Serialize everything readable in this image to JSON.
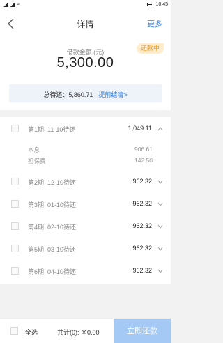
{
  "status_bar": {
    "time": "10:45"
  },
  "header": {
    "title": "详情",
    "more_label": "更多"
  },
  "summary": {
    "badge": "还款中",
    "amount_label": "借款金额 (元)",
    "amount_value": "5,300.00",
    "total_label": "总待还：",
    "total_value": "5,860.71",
    "prepay_label": "提前结清>"
  },
  "installments": [
    {
      "period": "第1期",
      "due": "11-10待还",
      "amount": "1,049.11",
      "expanded": true
    },
    {
      "period": "第2期",
      "due": "12-10待还",
      "amount": "962.32",
      "expanded": false
    },
    {
      "period": "第3期",
      "due": "01-10待还",
      "amount": "962.32",
      "expanded": false
    },
    {
      "period": "第4期",
      "due": "02-10待还",
      "amount": "962.32",
      "expanded": false
    },
    {
      "period": "第5期",
      "due": "03-10待还",
      "amount": "962.32",
      "expanded": false
    },
    {
      "period": "第6期",
      "due": "04-10待还",
      "amount": "962.32",
      "expanded": false
    }
  ],
  "first_detail": [
    {
      "label": "本息",
      "value": "906.61"
    },
    {
      "label": "担保费",
      "value": "142.50"
    }
  ],
  "footer": {
    "select_all": "全选",
    "total_selected": "共计(0): ￥0.00",
    "pay_button": "立即还款"
  },
  "colors": {
    "accent": "#2f7de1",
    "badge_bg": "#ffeccf",
    "badge_text": "#f09a19",
    "pay_button": "#a4c9f5"
  }
}
